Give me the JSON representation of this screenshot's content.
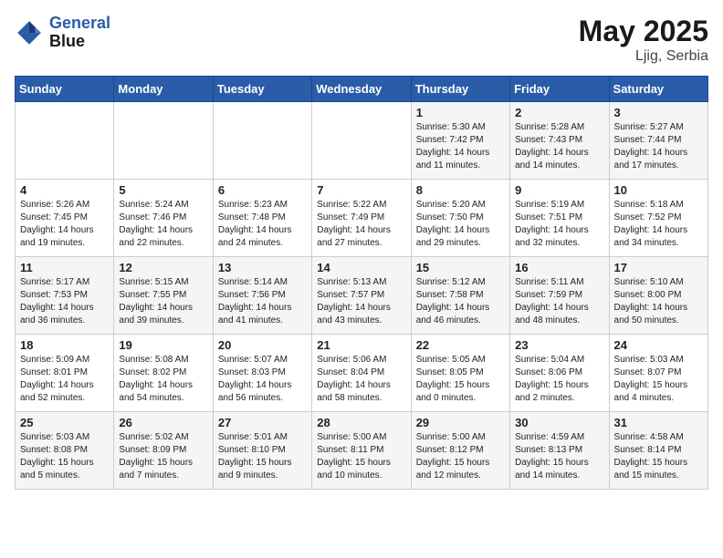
{
  "header": {
    "logo_line1": "General",
    "logo_line2": "Blue",
    "month": "May 2025",
    "location": "Ljig, Serbia"
  },
  "weekdays": [
    "Sunday",
    "Monday",
    "Tuesday",
    "Wednesday",
    "Thursday",
    "Friday",
    "Saturday"
  ],
  "weeks": [
    [
      {
        "day": "",
        "info": ""
      },
      {
        "day": "",
        "info": ""
      },
      {
        "day": "",
        "info": ""
      },
      {
        "day": "",
        "info": ""
      },
      {
        "day": "1",
        "info": "Sunrise: 5:30 AM\nSunset: 7:42 PM\nDaylight: 14 hours\nand 11 minutes."
      },
      {
        "day": "2",
        "info": "Sunrise: 5:28 AM\nSunset: 7:43 PM\nDaylight: 14 hours\nand 14 minutes."
      },
      {
        "day": "3",
        "info": "Sunrise: 5:27 AM\nSunset: 7:44 PM\nDaylight: 14 hours\nand 17 minutes."
      }
    ],
    [
      {
        "day": "4",
        "info": "Sunrise: 5:26 AM\nSunset: 7:45 PM\nDaylight: 14 hours\nand 19 minutes."
      },
      {
        "day": "5",
        "info": "Sunrise: 5:24 AM\nSunset: 7:46 PM\nDaylight: 14 hours\nand 22 minutes."
      },
      {
        "day": "6",
        "info": "Sunrise: 5:23 AM\nSunset: 7:48 PM\nDaylight: 14 hours\nand 24 minutes."
      },
      {
        "day": "7",
        "info": "Sunrise: 5:22 AM\nSunset: 7:49 PM\nDaylight: 14 hours\nand 27 minutes."
      },
      {
        "day": "8",
        "info": "Sunrise: 5:20 AM\nSunset: 7:50 PM\nDaylight: 14 hours\nand 29 minutes."
      },
      {
        "day": "9",
        "info": "Sunrise: 5:19 AM\nSunset: 7:51 PM\nDaylight: 14 hours\nand 32 minutes."
      },
      {
        "day": "10",
        "info": "Sunrise: 5:18 AM\nSunset: 7:52 PM\nDaylight: 14 hours\nand 34 minutes."
      }
    ],
    [
      {
        "day": "11",
        "info": "Sunrise: 5:17 AM\nSunset: 7:53 PM\nDaylight: 14 hours\nand 36 minutes."
      },
      {
        "day": "12",
        "info": "Sunrise: 5:15 AM\nSunset: 7:55 PM\nDaylight: 14 hours\nand 39 minutes."
      },
      {
        "day": "13",
        "info": "Sunrise: 5:14 AM\nSunset: 7:56 PM\nDaylight: 14 hours\nand 41 minutes."
      },
      {
        "day": "14",
        "info": "Sunrise: 5:13 AM\nSunset: 7:57 PM\nDaylight: 14 hours\nand 43 minutes."
      },
      {
        "day": "15",
        "info": "Sunrise: 5:12 AM\nSunset: 7:58 PM\nDaylight: 14 hours\nand 46 minutes."
      },
      {
        "day": "16",
        "info": "Sunrise: 5:11 AM\nSunset: 7:59 PM\nDaylight: 14 hours\nand 48 minutes."
      },
      {
        "day": "17",
        "info": "Sunrise: 5:10 AM\nSunset: 8:00 PM\nDaylight: 14 hours\nand 50 minutes."
      }
    ],
    [
      {
        "day": "18",
        "info": "Sunrise: 5:09 AM\nSunset: 8:01 PM\nDaylight: 14 hours\nand 52 minutes."
      },
      {
        "day": "19",
        "info": "Sunrise: 5:08 AM\nSunset: 8:02 PM\nDaylight: 14 hours\nand 54 minutes."
      },
      {
        "day": "20",
        "info": "Sunrise: 5:07 AM\nSunset: 8:03 PM\nDaylight: 14 hours\nand 56 minutes."
      },
      {
        "day": "21",
        "info": "Sunrise: 5:06 AM\nSunset: 8:04 PM\nDaylight: 14 hours\nand 58 minutes."
      },
      {
        "day": "22",
        "info": "Sunrise: 5:05 AM\nSunset: 8:05 PM\nDaylight: 15 hours\nand 0 minutes."
      },
      {
        "day": "23",
        "info": "Sunrise: 5:04 AM\nSunset: 8:06 PM\nDaylight: 15 hours\nand 2 minutes."
      },
      {
        "day": "24",
        "info": "Sunrise: 5:03 AM\nSunset: 8:07 PM\nDaylight: 15 hours\nand 4 minutes."
      }
    ],
    [
      {
        "day": "25",
        "info": "Sunrise: 5:03 AM\nSunset: 8:08 PM\nDaylight: 15 hours\nand 5 minutes."
      },
      {
        "day": "26",
        "info": "Sunrise: 5:02 AM\nSunset: 8:09 PM\nDaylight: 15 hours\nand 7 minutes."
      },
      {
        "day": "27",
        "info": "Sunrise: 5:01 AM\nSunset: 8:10 PM\nDaylight: 15 hours\nand 9 minutes."
      },
      {
        "day": "28",
        "info": "Sunrise: 5:00 AM\nSunset: 8:11 PM\nDaylight: 15 hours\nand 10 minutes."
      },
      {
        "day": "29",
        "info": "Sunrise: 5:00 AM\nSunset: 8:12 PM\nDaylight: 15 hours\nand 12 minutes."
      },
      {
        "day": "30",
        "info": "Sunrise: 4:59 AM\nSunset: 8:13 PM\nDaylight: 15 hours\nand 14 minutes."
      },
      {
        "day": "31",
        "info": "Sunrise: 4:58 AM\nSunset: 8:14 PM\nDaylight: 15 hours\nand 15 minutes."
      }
    ]
  ]
}
